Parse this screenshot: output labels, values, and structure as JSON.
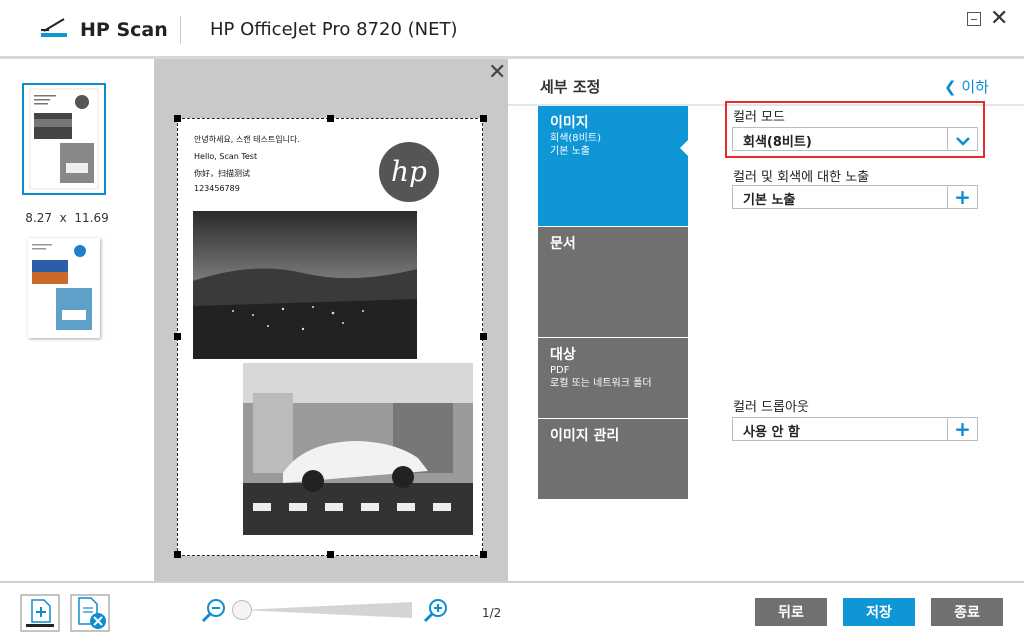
{
  "app": {
    "title": "HP Scan",
    "device": "HP OfficeJet Pro 8720 (NET)"
  },
  "thumbnails": {
    "size_label": "8.27  x  11.69",
    "count": 2,
    "selected": 1
  },
  "preview": {
    "text_lines": [
      "안녕하세요, 스캔 테스트입니다.",
      "Hello, Scan Test",
      "你好，扫描测试",
      "123456789"
    ]
  },
  "settings": {
    "title": "세부 조정",
    "back_label": "이하",
    "tabs": [
      {
        "label": "이미지",
        "sub": [
          "회색(8비트)",
          "기본 노출"
        ]
      },
      {
        "label": "문서",
        "sub": []
      },
      {
        "label": "대상",
        "sub": [
          "PDF",
          "로컬 또는 네트워크 폴더"
        ]
      },
      {
        "label": "이미지 관리",
        "sub": []
      }
    ],
    "fields": {
      "color_mode": {
        "label": "컬러 모드",
        "value": "회색(8비트)"
      },
      "exposure": {
        "label": "컬러 및 회색에 대한 노출",
        "value": "기본 노출"
      },
      "dropout": {
        "label": "컬러 드롭아웃",
        "value": "사용 안 함"
      }
    }
  },
  "bottom": {
    "page_count": "1/2",
    "zoom_level": 0.0,
    "back_button": "뒤로",
    "save_button": "저장",
    "exit_button": "종료"
  },
  "colors": {
    "accent": "#0e96d6",
    "tab_inactive": "#707070",
    "highlight": "#e52b2b"
  }
}
